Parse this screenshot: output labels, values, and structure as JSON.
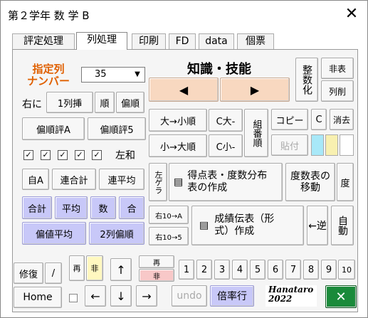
{
  "window": {
    "title": "第２学年  数 学 B",
    "close": "✕"
  },
  "tabs": [
    "評定処理",
    "列処理",
    "印刷",
    "FD",
    "data",
    "個票"
  ],
  "colnum": {
    "label1": "指定列",
    "label2": "ナンバー",
    "value": "35"
  },
  "row1": {
    "migi": "右に",
    "insert": "1列挿",
    "jun": "順",
    "hen": "偏順"
  },
  "row2": {
    "a": "偏順評A",
    "b": "偏順評5"
  },
  "checks": [
    "✓",
    "✓",
    "✓",
    "✓",
    "✓"
  ],
  "sawa": "左和",
  "row4": {
    "a": "自A",
    "b": "連合計",
    "c": "連平均"
  },
  "row5": {
    "a": "合計",
    "b": "平均",
    "c": "数",
    "d": "合"
  },
  "row6": {
    "a": "偏値平均",
    "b": "2列偏順"
  },
  "header": {
    "title": "知識・技能",
    "left": "◀",
    "right": "▶"
  },
  "side": {
    "seisuka": "整数化",
    "hiyou": "非表",
    "retsusaku": "列削"
  },
  "sort": {
    "a": "大→小順",
    "b": "C大-",
    "c": "小→大順",
    "d": "C小-",
    "kumi": "組番順"
  },
  "copy": {
    "copy": "コピー",
    "c": "C",
    "kesu": "消去",
    "paste": "貼付"
  },
  "swatches": [
    "#a8e8f8",
    "#f8f0b0",
    "#ffffff"
  ],
  "make": {
    "hidari": "左ゲラ",
    "tokuten": "得点表・度数分布表の作成",
    "dosuu": "度数表の移動",
    "do": "度"
  },
  "bottom": {
    "r10a": "右10→A",
    "r10_5": "右10→5",
    "seiseki": "成績伝表（形式）作成",
    "gyaku": "←逆",
    "jidou": "自動"
  },
  "nav": {
    "shufuku": "修復",
    "slash": "/",
    "sai": "再",
    "hi": "非",
    "re2": "再",
    "hi2": "非",
    "up": "↑",
    "left": "←",
    "down": "↓",
    "right": "→",
    "home": "Home",
    "undo": "undo",
    "bairitsu": "倍率行"
  },
  "numbers": [
    "1",
    "2",
    "3",
    "4",
    "5",
    "6",
    "7",
    "8",
    "9",
    "10"
  ],
  "signature": {
    "line1": "Hanataro",
    "line2": "2022"
  },
  "exit": "✕"
}
